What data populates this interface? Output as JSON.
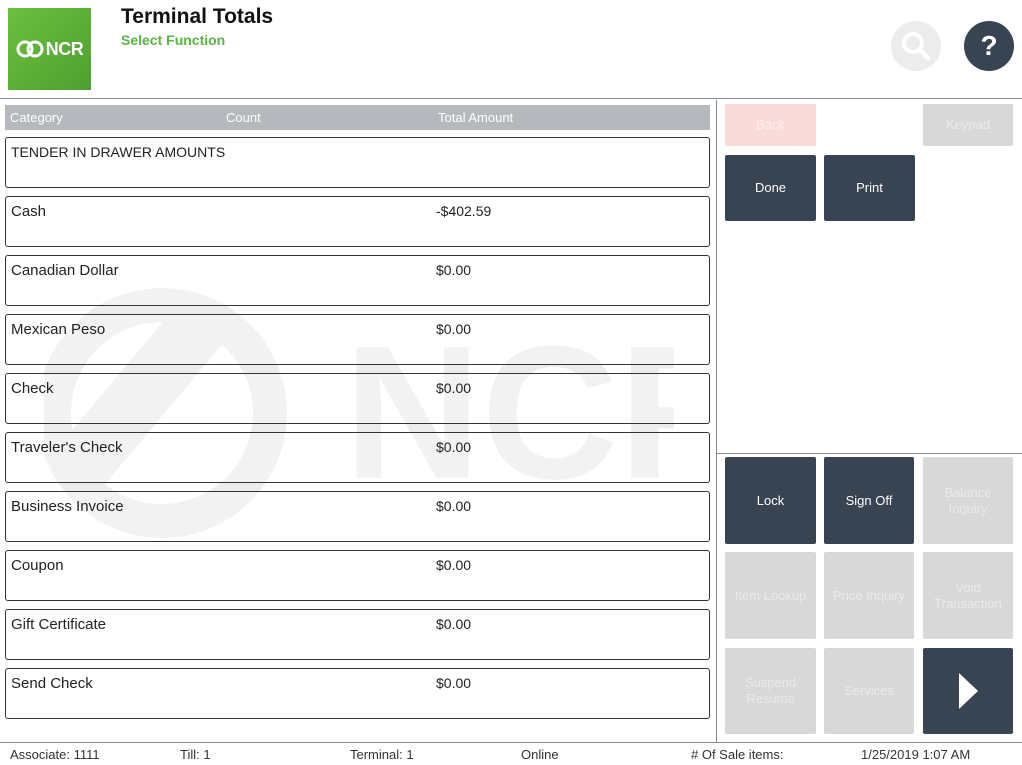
{
  "header": {
    "logo_text": "NCR",
    "title": "Terminal Totals",
    "subtitle": "Select Function",
    "help_label": "?"
  },
  "table": {
    "columns": [
      "Category",
      "Count",
      "Total Amount"
    ],
    "rows": [
      {
        "category": "TENDER IN DRAWER AMOUNTS",
        "count": "",
        "amount": ""
      },
      {
        "category": "Cash",
        "count": "",
        "amount": "-$402.59"
      },
      {
        "category": "Canadian Dollar",
        "count": "",
        "amount": "$0.00"
      },
      {
        "category": "Mexican Peso",
        "count": "",
        "amount": "$0.00"
      },
      {
        "category": "Check",
        "count": "",
        "amount": "$0.00"
      },
      {
        "category": "Traveler's Check",
        "count": "",
        "amount": "$0.00"
      },
      {
        "category": "Business Invoice",
        "count": "",
        "amount": "$0.00"
      },
      {
        "category": "Coupon",
        "count": "",
        "amount": "$0.00"
      },
      {
        "category": "Gift Certificate",
        "count": "",
        "amount": "$0.00"
      },
      {
        "category": "Send Check",
        "count": "",
        "amount": "$0.00"
      }
    ]
  },
  "watermark_text": "NCR",
  "top_buttons": {
    "back": "Back",
    "keypad": "Keypad",
    "done": "Done",
    "print": "Print"
  },
  "function_buttons": {
    "lock": "Lock",
    "sign_off": "Sign Off",
    "balance_inquiry": "Balance Inquiry",
    "item_lookup": "Item Lookup",
    "price_inquiry": "Price Inquiry",
    "void_transaction": "Void Transaction",
    "suspend_resume": "Suspend Resume",
    "services": "Services"
  },
  "status": {
    "associate": "Associate: 1111",
    "till": "Till: 1",
    "terminal": "Terminal: 1",
    "connection": "Online",
    "sale_items": "# Of Sale items:",
    "datetime": "1/25/2019 1:07 AM"
  },
  "colors": {
    "brand_green": "#5ab544",
    "dark_button": "#384452",
    "disabled_button": "#d8d8d8",
    "header_gray": "#b5b8bc"
  }
}
